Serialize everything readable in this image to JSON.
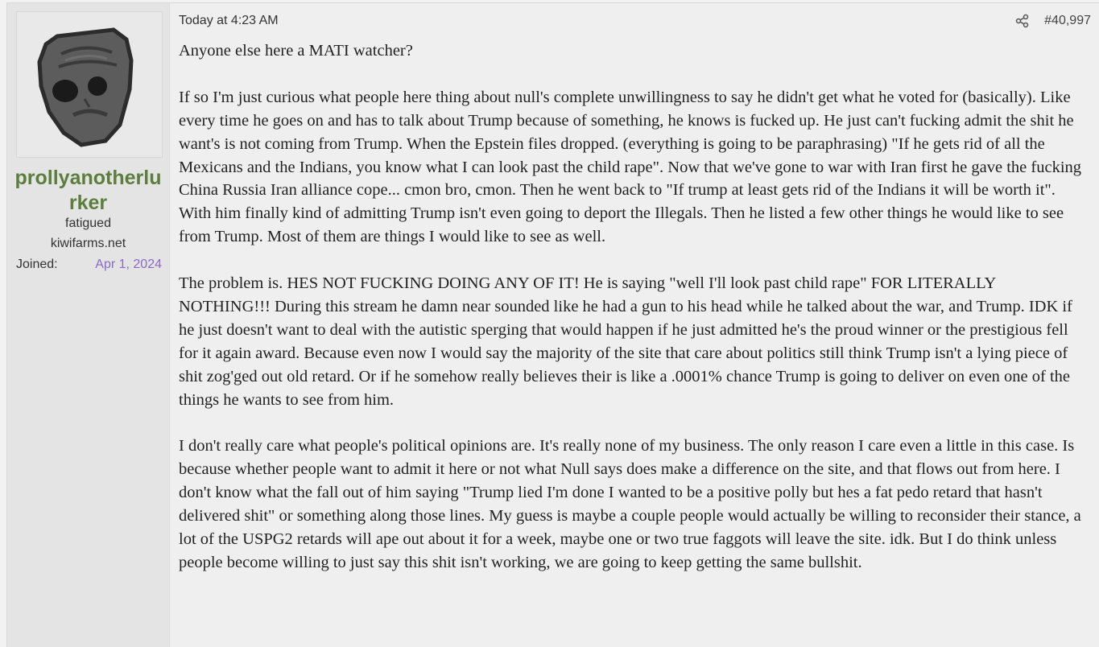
{
  "user": {
    "name": "prollyanotherlurker",
    "title": "fatigued",
    "banner": "kiwifarms.net",
    "joined_label": "Joined:",
    "joined_date": "Apr 1, 2024",
    "avatar_icon": "gray-sad-face-avatar-icon"
  },
  "post": {
    "date": "Today at 4:23 AM",
    "share_icon": "share-icon",
    "number": "#40,997",
    "paragraphs": [
      "Anyone else here a MATI watcher?",
      "If so I'm just curious what people here thing about null's complete unwillingness to say he didn't get what he voted for (basically). Like every time he goes on and has to talk about Trump because of something, he knows is fucked up. He just can't fucking admit the shit he want's is not coming from Trump. When the Epstein files dropped. (everything is going to be paraphrasing) \"If he gets rid of all the Mexicans and the Indians, you know what I can look past the child rape\". Now that we've gone to war with Iran first he gave the fucking China Russia Iran alliance cope... cmon bro, cmon. Then he went back to \"If trump at least gets rid of the Indians it will be worth it\". With him finally kind of admitting Trump isn't even going to deport the Illegals. Then he listed a few other things he would like to see from Trump. Most of them are things I would like to see as well.",
      "The problem is. HES NOT FUCKING DOING ANY OF IT! He is saying \"well I'll look past child rape\" FOR LITERALLY NOTHING!!! During this stream he damn near sounded like he had a gun to his head while he talked about the war, and Trump. IDK if he just doesn't want to deal with the autistic sperging that would happen if he just admitted he's the proud winner or the prestigious fell for it again award. Because even now I would say the majority of the site that care about politics still think Trump isn't a lying piece of shit zog'ged out old retard. Or if he somehow really believes their is like a .0001% chance Trump is going to deliver on even one of the things he wants to see from him.",
      "I don't really care what people's political opinions are. It's really none of my business. The only reason I care even a little in this case. Is because whether people want to admit it here or not what Null says does make a difference on the site, and that flows out from here. I don't know what the fall out of him saying \"Trump lied I'm done I wanted to be a positive polly but hes a fat pedo retard that hasn't delivered shit\" or something along those lines. My guess is maybe a couple people would actually be willing to reconsider their stance, a lot of the USPG2 retards will ape out about it for a week, maybe one or two true faggots will leave the site. idk. But I do think unless people become willing to just say this shit isn't working, we are going to keep getting the same bullshit."
    ]
  }
}
